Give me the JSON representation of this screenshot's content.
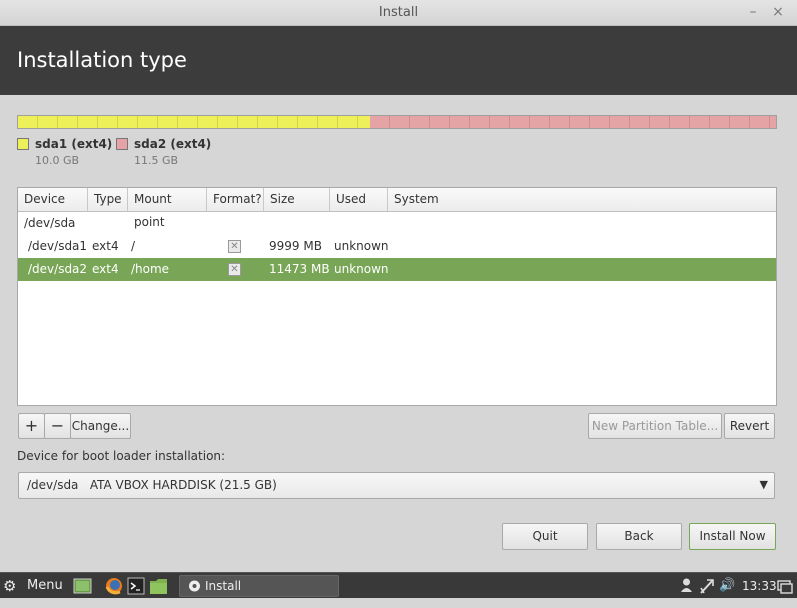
{
  "window": {
    "title": "Install",
    "minimize_glyph": "–",
    "close_glyph": "×"
  },
  "header": {
    "title": "Installation type"
  },
  "disk_bar": {
    "segments": [
      {
        "name": "sda1 (ext4)",
        "size": "10.0 GB",
        "color": "#eef05a",
        "fraction": 0.465
      },
      {
        "name": "sda2 (ext4)",
        "size": "11.5 GB",
        "color": "#e5a3a6",
        "fraction": 0.535
      }
    ]
  },
  "table": {
    "columns": [
      "Device",
      "Type",
      "Mount point",
      "Format?",
      "Size",
      "Used",
      "System"
    ],
    "rows": [
      {
        "device": "/dev/sda",
        "type": "",
        "mount": "",
        "format": "",
        "size": "",
        "used": "",
        "system": ""
      },
      {
        "device": "/dev/sda1",
        "type": "ext4",
        "mount": "/",
        "format": "✕",
        "size": "9999 MB",
        "used": "unknown",
        "system": ""
      },
      {
        "device": "/dev/sda2",
        "type": "ext4",
        "mount": "/home",
        "format": "✕",
        "size": "11473 MB",
        "used": "unknown",
        "system": "",
        "selected": true
      }
    ]
  },
  "partition_buttons": {
    "add": "+",
    "remove": "−",
    "change": "Change...",
    "new_table": "New Partition Table...",
    "revert": "Revert"
  },
  "bootloader": {
    "label": "Device for boot loader installation:",
    "value": "/dev/sda   ATA VBOX HARDDISK (21.5 GB)"
  },
  "nav_buttons": {
    "quit": "Quit",
    "back": "Back",
    "install": "Install Now"
  },
  "panel": {
    "menu_label": "Menu",
    "task_label": "Install",
    "clock": "13:33",
    "accent": "#78a656",
    "icons": [
      "gear-icon",
      "show-desktop-icon",
      "firefox-icon",
      "terminal-icon",
      "folder-icon",
      "user-icon",
      "network-icon",
      "volume-icon",
      "windows-icon"
    ]
  }
}
